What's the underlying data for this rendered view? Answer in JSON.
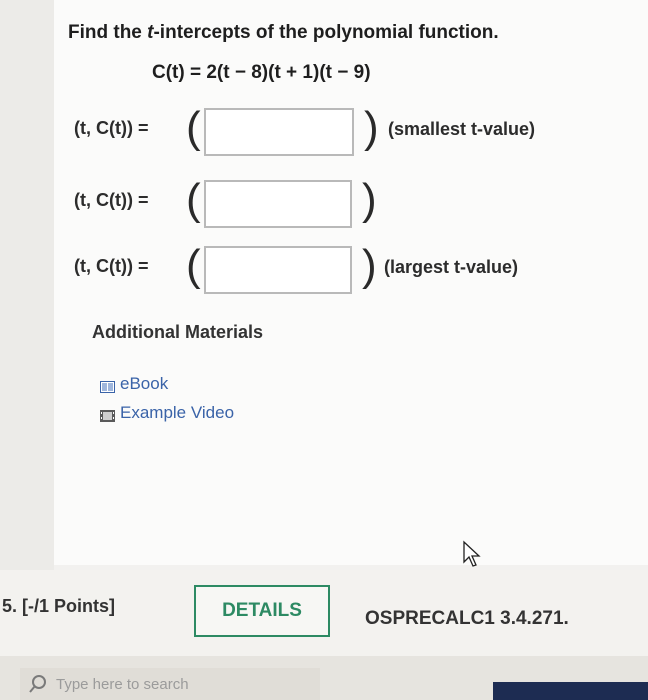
{
  "question": {
    "prompt_before": "Find the ",
    "prompt_var": "t",
    "prompt_after": "-intercepts of the polynomial function.",
    "equation": "C(t) = 2(t − 8)(t + 1)(t − 9)"
  },
  "answers": [
    {
      "label": "(t, C(t)) =",
      "value": "",
      "note": "(smallest t-value)"
    },
    {
      "label": "(t, C(t)) =",
      "value": "",
      "note": ""
    },
    {
      "label": "(t, C(t)) =",
      "value": "",
      "note": "(largest t-value)"
    }
  ],
  "additional": {
    "title": "Additional Materials",
    "items": [
      {
        "label": "eBook",
        "icon": "ebook-icon"
      },
      {
        "label": "Example Video",
        "icon": "video-icon"
      }
    ]
  },
  "next_question": {
    "points": "5. [-/1 Points]",
    "details_label": "DETAILS",
    "course_ref": "OSPRECALC1 3.4.271."
  },
  "taskbar": {
    "search_placeholder": "Type here to search"
  },
  "colors": {
    "accent_green": "#2d8a63",
    "link_blue": "#3a63a8"
  }
}
